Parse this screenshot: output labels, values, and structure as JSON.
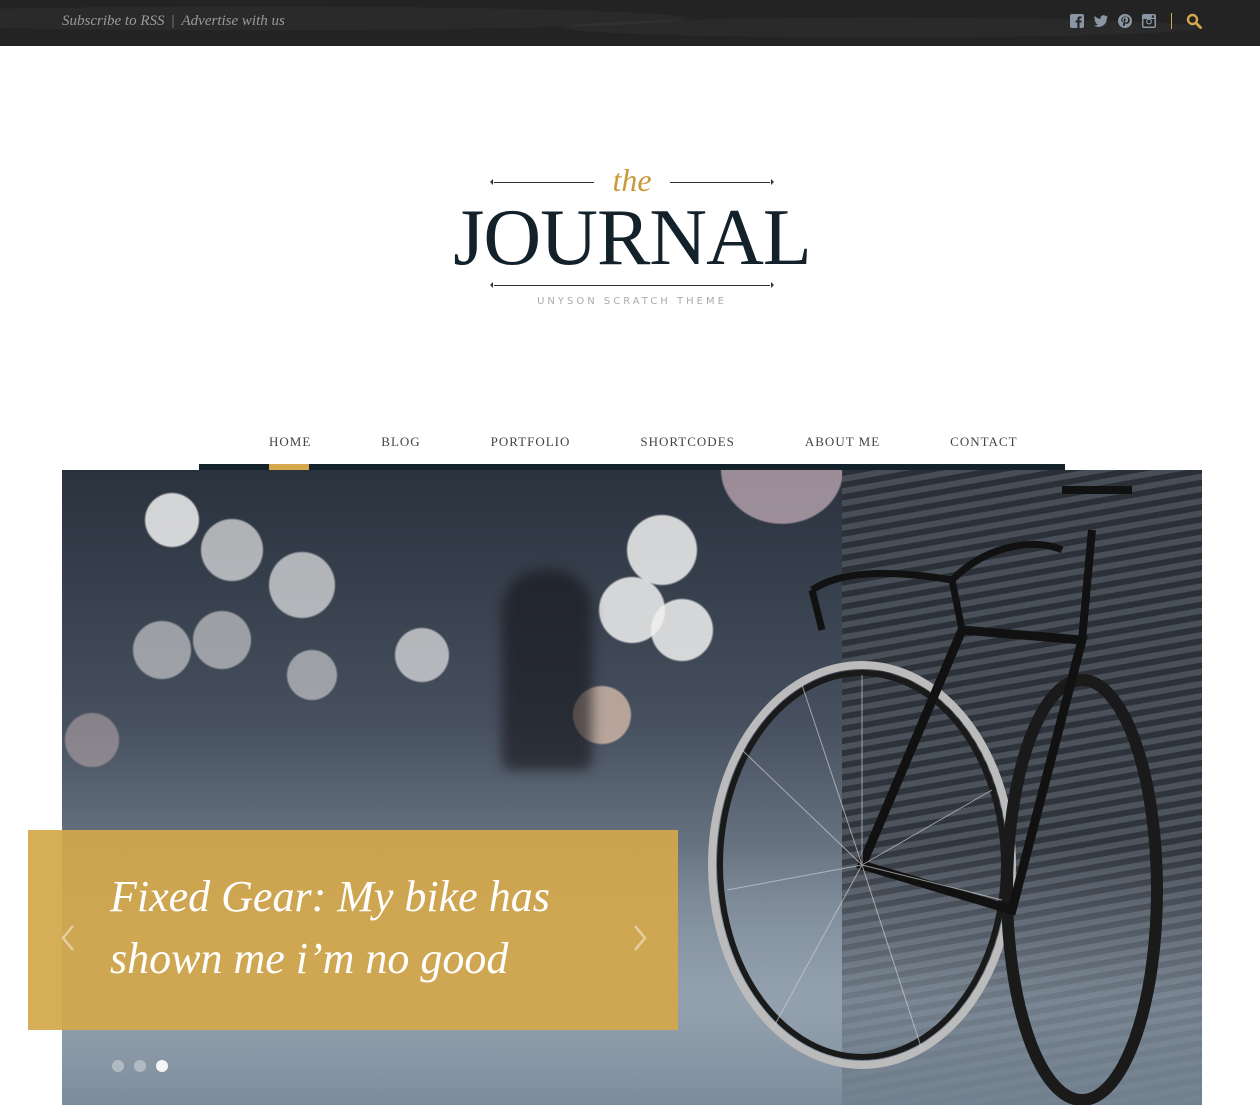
{
  "topbar": {
    "links": [
      "Subscribe to RSS",
      "Advertise with us"
    ],
    "separator": "|",
    "social_icons": [
      "facebook-icon",
      "twitter-icon",
      "pinterest-icon",
      "instagram-icon"
    ],
    "search_icon": "search-icon"
  },
  "logo": {
    "the": "the",
    "title": "JOURNAL",
    "tagline": "UNYSON SCRATCH THEME"
  },
  "nav": {
    "items": [
      {
        "label": "HOME",
        "active": true
      },
      {
        "label": "BLOG"
      },
      {
        "label": "PORTFOLIO"
      },
      {
        "label": "SHORTCODES"
      },
      {
        "label": "ABOUT ME"
      },
      {
        "label": "CONTACT"
      }
    ]
  },
  "slider": {
    "caption": "Fixed Gear: My bike has shown me i’m no good",
    "prev_icon": "chevron-left-icon",
    "next_icon": "chevron-right-icon",
    "slide_count": 3,
    "active_slide": 3
  },
  "colors": {
    "accent": "#d4a84b",
    "dark": "#13212a",
    "topbar": "#232323"
  }
}
